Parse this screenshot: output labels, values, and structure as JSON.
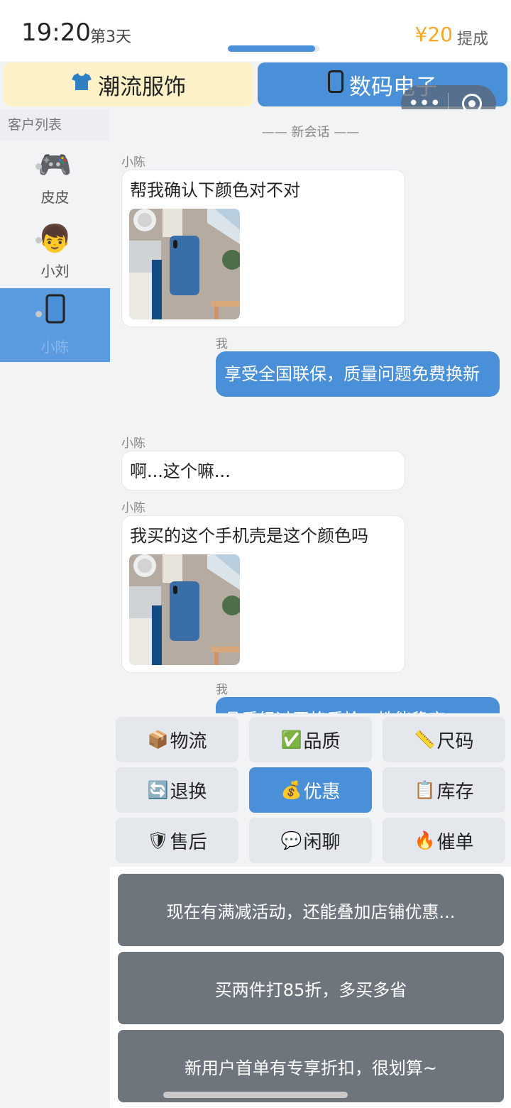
{
  "status": {
    "time": "19:20",
    "day": "第3天",
    "money": "¥20",
    "commission": "提成",
    "progress_percent": 95
  },
  "tabs": [
    {
      "label": "潮流服饰",
      "icon": "t-shirt-icon",
      "active": false
    },
    {
      "label": "数码电子",
      "icon": "phone-icon",
      "active": true
    }
  ],
  "capsule": {
    "more": "•••"
  },
  "sidebar": {
    "title": "客户列表",
    "customers": [
      {
        "name": "皮皮",
        "avatar": "🎮",
        "active": false
      },
      {
        "name": "小刘",
        "avatar": "👦",
        "active": false
      },
      {
        "name": "小陈",
        "avatar": "📱",
        "active": true
      }
    ]
  },
  "chat": {
    "divider": "—— 新会话 ——",
    "messages": [
      {
        "from": "小陈",
        "text": "帮我确认下颜色对不对",
        "has_image": true
      },
      {
        "from": "我",
        "text": "享受全国联保，质量问题免费换新"
      },
      {
        "from": "小陈",
        "text": "啊...这个嘛..."
      },
      {
        "from": "小陈",
        "text": "我买的这个手机壳是这个颜色吗",
        "has_image": true
      },
      {
        "from": "我",
        "text": "品质经过严格质检，性能稳定"
      }
    ]
  },
  "quick": [
    {
      "icon": "📦",
      "label": "物流",
      "active": false
    },
    {
      "icon": "✅",
      "label": "品质",
      "active": false
    },
    {
      "icon": "📏",
      "label": "尺码",
      "active": false
    },
    {
      "icon": "🔄",
      "label": "退换",
      "active": false
    },
    {
      "icon": "💰",
      "label": "优惠",
      "active": true
    },
    {
      "icon": "📋",
      "label": "库存",
      "active": false
    },
    {
      "icon": "🛡",
      "label": "售后",
      "active": false
    },
    {
      "icon": "💬",
      "label": "闲聊",
      "active": false
    },
    {
      "icon": "🔥",
      "label": "催单",
      "active": false
    }
  ],
  "replies": [
    "现在有满减活动，还能叠加店铺优惠...",
    "买两件打85折，多买多省",
    "新用户首单有专享折扣，很划算~"
  ],
  "colors": {
    "accent": "#4a90d9",
    "money": "#f5a623",
    "reply_bg": "#6e757d",
    "tab_inactive": "#fdf1c8"
  }
}
